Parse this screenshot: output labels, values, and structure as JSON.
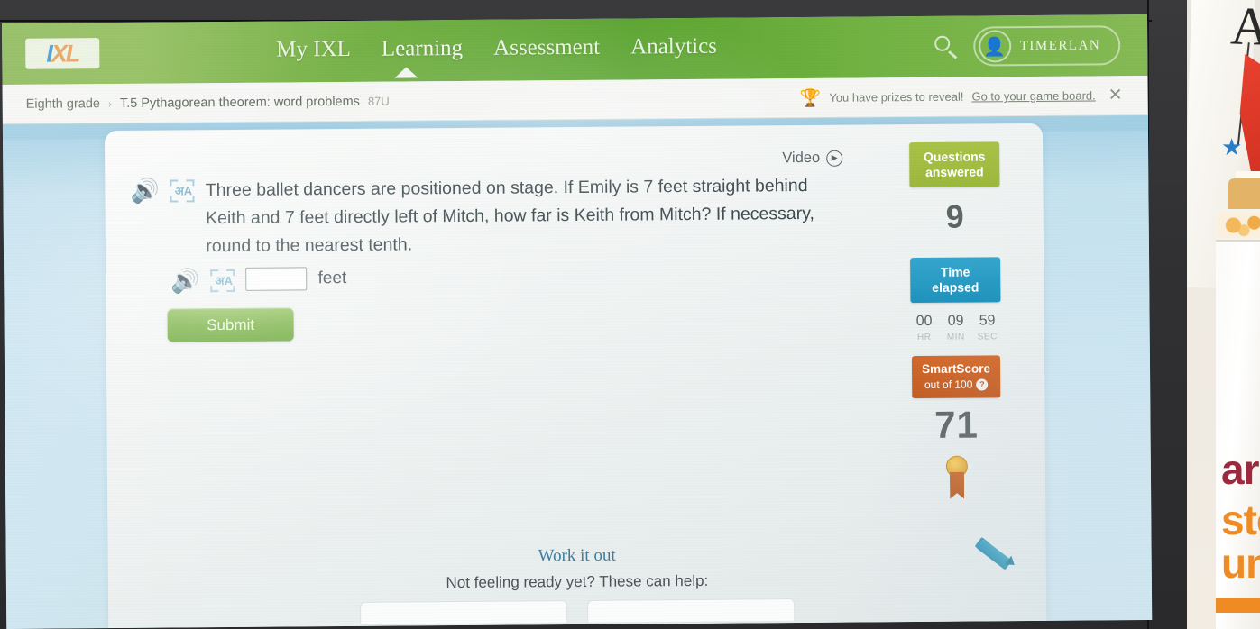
{
  "nav": {
    "logo": {
      "part1": "I",
      "part2": "XL"
    },
    "items": [
      {
        "label": "My IXL",
        "active": false
      },
      {
        "label": "Learning",
        "active": true
      },
      {
        "label": "Assessment",
        "active": false
      },
      {
        "label": "Analytics",
        "active": false
      }
    ],
    "search_icon": "search-icon",
    "avatar_icon": "person-icon",
    "username": "TIMERLAN"
  },
  "breadcrumb": {
    "grade": "Eighth grade",
    "separator": "›",
    "skill": "T.5 Pythagorean theorem: word problems",
    "code": "87U"
  },
  "prize_banner": {
    "trophy_icon": "trophy-icon",
    "message": "You have prizes to reveal!",
    "link": "Go to your game board.",
    "close_icon": "✕"
  },
  "video": {
    "label": "Video",
    "play_icon": "▶"
  },
  "question": {
    "speaker_icon": "🔊",
    "translate_icon": "translate-icon",
    "text": "Three ballet dancers are positioned on stage. If Emily is 7 feet straight behind Keith and 7 feet directly left of Mitch, how far is Keith from Mitch? If necessary, round to the nearest tenth.",
    "answer_value": "",
    "answer_placeholder": "",
    "unit": "feet",
    "submit_label": "Submit"
  },
  "work_it_out": {
    "title": "Work it out",
    "subtitle": "Not feeling ready yet? These can help:"
  },
  "sidebar": {
    "questions_answered": {
      "title_line1": "Questions",
      "title_line2": "answered",
      "value": "9",
      "color": "#9cb83c"
    },
    "time_elapsed": {
      "title_line1": "Time",
      "title_line2": "elapsed",
      "color": "#1f93bd",
      "hours": "00",
      "minutes": "09",
      "seconds": "59",
      "hours_label": "HR",
      "minutes_label": "MIN",
      "seconds_label": "SEC"
    },
    "smartscore": {
      "title": "SmartScore",
      "subtitle": "out of 100",
      "help_icon": "?",
      "value": "71",
      "color": "#c25a1f"
    },
    "award_icon": "award-ribbon-icon",
    "pencil_icon": "pencil-icon"
  },
  "environment": {
    "paper_letter": "A",
    "star_icon": "★",
    "cup_text_line1": "aru",
    "cup_text_line2": "sto",
    "cup_text_line3": "un"
  }
}
